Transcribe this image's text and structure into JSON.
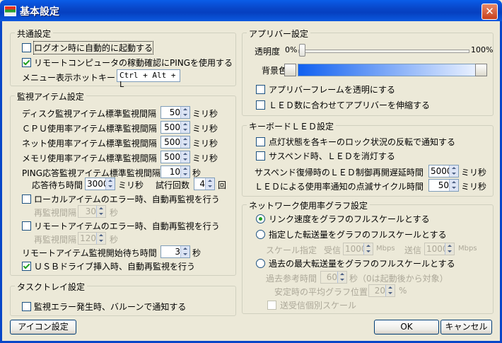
{
  "window": {
    "title": "基本設定",
    "close": "✕"
  },
  "common": {
    "title": "共通設定",
    "autostart": "ログオン時に自動的に起動する",
    "ping": "リモートコンピュータの稼動確認にPINGを使用する",
    "hotkey_label": "メニュー表示ホットキー",
    "hotkey_value": "Ctrl + Alt + L"
  },
  "monitor": {
    "title": "監視アイテム設定",
    "rows": [
      {
        "label": "ディスク監視アイテム標準監視間隔",
        "value": "50",
        "unit": "ミリ秒"
      },
      {
        "label": "ＣＰＵ使用率アイテム標準監視間隔",
        "value": "500",
        "unit": "ミリ秒"
      },
      {
        "label": "ネット使用率アイテム標準監視間隔",
        "value": "500",
        "unit": "ミリ秒"
      },
      {
        "label": "メモリ使用率アイテム標準監視間隔",
        "value": "500",
        "unit": "ミリ秒"
      },
      {
        "label": "PING応答監視アイテム標準監視間隔",
        "value": "10",
        "unit": "秒"
      }
    ],
    "timeout_label": "応答待ち時間",
    "timeout_value": "3000",
    "timeout_unit": "ミリ秒",
    "retry_label": "試行回数",
    "retry_value": "4",
    "retry_unit": "回",
    "local_err": "ローカルアイテムのエラー時、自動再監視を行う",
    "local_interval_label": "再監視間隔",
    "local_interval_value": "30",
    "local_interval_unit": "秒",
    "remote_err": "リモートアイテムのエラー時、自動再監視を行う",
    "remote_interval_label": "再監視間隔",
    "remote_interval_value": "120",
    "remote_interval_unit": "秒",
    "remote_wait_label": "リモートアイテム監視開始待ち時間",
    "remote_wait_value": "3",
    "remote_wait_unit": "秒",
    "usb": "ＵＳＢドライブ挿入時、自動再監視を行う"
  },
  "tasktray": {
    "title": "タスクトレイ設定",
    "balloon": "監視エラー発生時、バルーンで通知する"
  },
  "appbar": {
    "title": "アプリバー設定",
    "transparency_label": "透明度",
    "min": "0%",
    "max": "100%",
    "transparency_value": 0,
    "bg_label": "背景色",
    "frame_transparent": "アプリバーフレームを透明にする",
    "stretch": "ＬＥＤ数に合わせてアプリバーを伸縮する",
    "color": "#1060f0"
  },
  "keyboard": {
    "title": "キーボードＬＥＤ設定",
    "lock_notify": "点灯状態を各キーのロック状況の反転で通知する",
    "suspend_off": "サスペンド時、ＬＥＤを消灯する",
    "resume_label": "サスペンド復帰時のＬＥＤ制御再開遅延時間",
    "resume_value": "5000",
    "resume_unit": "ミリ秒",
    "blink_label": "ＬＥＤによる使用率通知の点滅サイクル時間",
    "blink_value": "50",
    "blink_unit": "ミリ秒"
  },
  "netgraph": {
    "title": "ネットワーク使用率グラフ設定",
    "opt1": "リンク速度をグラフのフルスケールとする",
    "opt2": "指定した転送量をグラフのフルスケールとする",
    "scale_label": "スケール指定",
    "recv_label": "受信",
    "recv_value": "1000",
    "recv_unit": "Mbps",
    "send_label": "送信",
    "send_value": "1000",
    "send_unit": "Mbps",
    "opt3": "過去の最大転送量をグラフのフルスケールとする",
    "ref_label": "過去参考時間",
    "ref_value": "60",
    "ref_unit": "秒（0は起動後から対象）",
    "avg_label": "安定時の平均グラフ位置",
    "avg_value": "20",
    "avg_unit": "%",
    "separate": "送受信個別スケール"
  },
  "buttons": {
    "icon": "アイコン設定",
    "ok": "OK",
    "cancel": "キャンセル"
  }
}
